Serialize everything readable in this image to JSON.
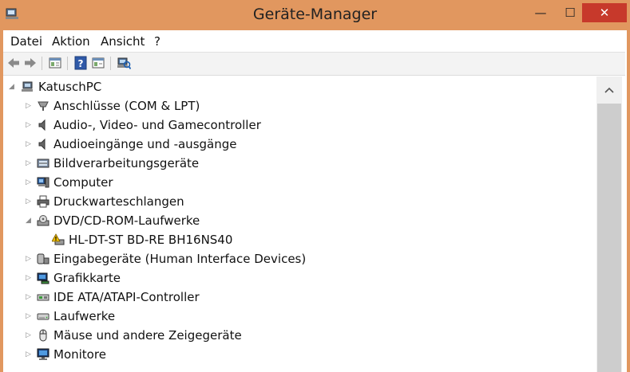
{
  "window": {
    "title": "Geräte-Manager",
    "minimize_glyph": "—",
    "maximize_glyph": "☐",
    "close_glyph": "✕"
  },
  "menu": [
    "Datei",
    "Aktion",
    "Ansicht",
    "?"
  ],
  "toolbar": {
    "buttons": [
      "back-arrow-icon",
      "forward-arrow-icon",
      "properties-icon",
      "help-icon",
      "show-hidden-icon",
      "scan-hardware-icon"
    ]
  },
  "tree": {
    "root": "KatuschPC",
    "items": [
      {
        "label": "Anschlüsse (COM & LPT)",
        "icon": "port-icon",
        "expanded": false
      },
      {
        "label": "Audio-, Video- und Gamecontroller",
        "icon": "speaker-icon",
        "expanded": false
      },
      {
        "label": "Audioeingänge und -ausgänge",
        "icon": "speaker-icon",
        "expanded": false
      },
      {
        "label": "Bildverarbeitungsgeräte",
        "icon": "camera-icon",
        "expanded": false
      },
      {
        "label": "Computer",
        "icon": "computer-icon",
        "expanded": false
      },
      {
        "label": "Druckwarteschlangen",
        "icon": "printer-icon",
        "expanded": false
      },
      {
        "label": "DVD/CD-ROM-Laufwerke",
        "icon": "optical-drive-icon",
        "expanded": true
      },
      {
        "label": "HL-DT-ST BD-RE  BH16NS40",
        "icon": "warning-drive-icon",
        "child": true
      },
      {
        "label": "Eingabegeräte (Human Interface Devices)",
        "icon": "hid-icon",
        "expanded": false
      },
      {
        "label": "Grafikkarte",
        "icon": "display-adapter-icon",
        "expanded": false
      },
      {
        "label": "IDE ATA/ATAPI-Controller",
        "icon": "ide-controller-icon",
        "expanded": false
      },
      {
        "label": "Laufwerke",
        "icon": "disk-drive-icon",
        "expanded": false
      },
      {
        "label": "Mäuse und andere Zeigegeräte",
        "icon": "mouse-icon",
        "expanded": false
      },
      {
        "label": "Monitore",
        "icon": "monitor-icon",
        "expanded": false
      }
    ]
  },
  "colors": {
    "frame": "#e1975f",
    "close": "#c7392b",
    "toolbar": "#f3f3f3",
    "scroll_thumb": "#cdcdcd"
  }
}
